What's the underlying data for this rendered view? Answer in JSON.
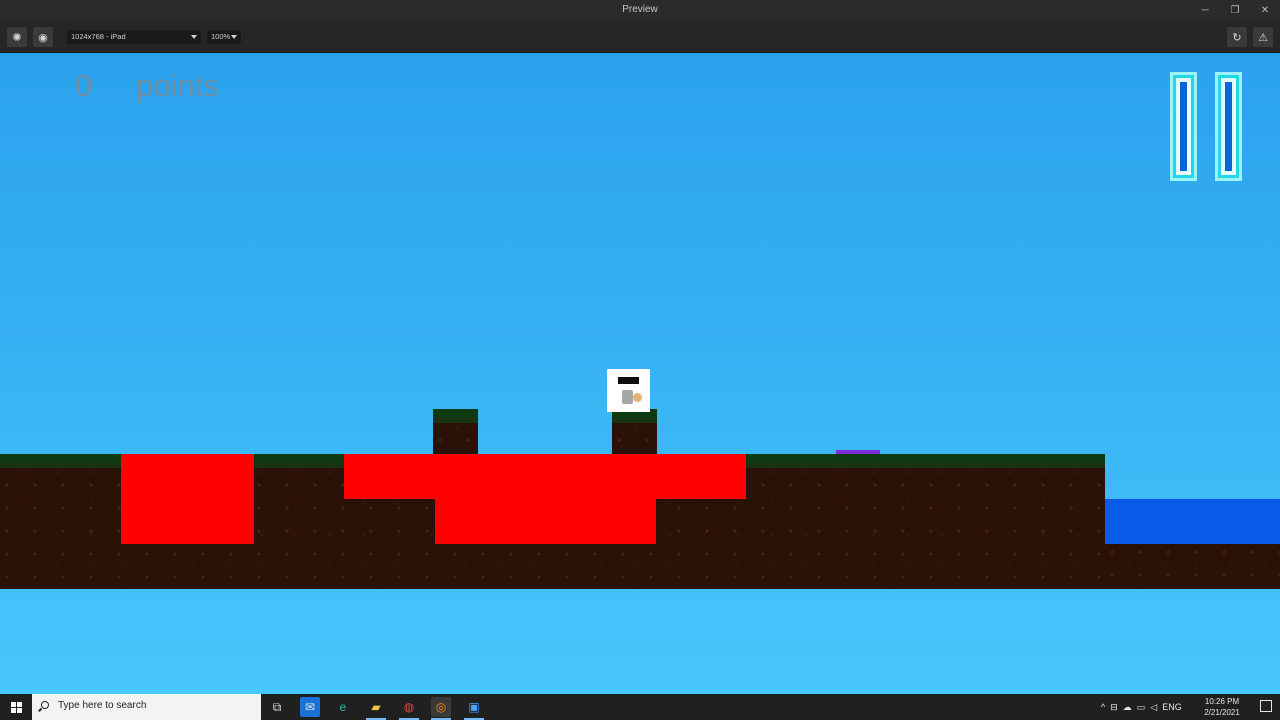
{
  "window": {
    "title": "Preview",
    "controls": {
      "minimize": "─",
      "restore": "❐",
      "close": "✕"
    }
  },
  "toolbar": {
    "device_select": "1024x768 - iPad",
    "zoom_select": "100%",
    "icons": [
      "bug-icon",
      "camera-icon",
      "refresh-icon",
      "warning-icon"
    ]
  },
  "game": {
    "score_value": "0",
    "score_label": "points",
    "pause_icon": "pause-icon",
    "colors": {
      "sky": "#36b1f3",
      "lava": "#ff0000",
      "water": "#075be8",
      "grass": "#0d3a11",
      "dirt": "#2b1208",
      "pause_fill": "#0b64d8"
    }
  },
  "taskbar": {
    "search_placeholder": "Type here to search",
    "apps": [
      "task-view-icon",
      "mail-icon",
      "edge-icon",
      "file-explorer-icon",
      "chrome-icon",
      "app-icon",
      "photos-icon"
    ],
    "language": "ENG",
    "time": "10:26 PM",
    "date": "2/21/2021"
  }
}
